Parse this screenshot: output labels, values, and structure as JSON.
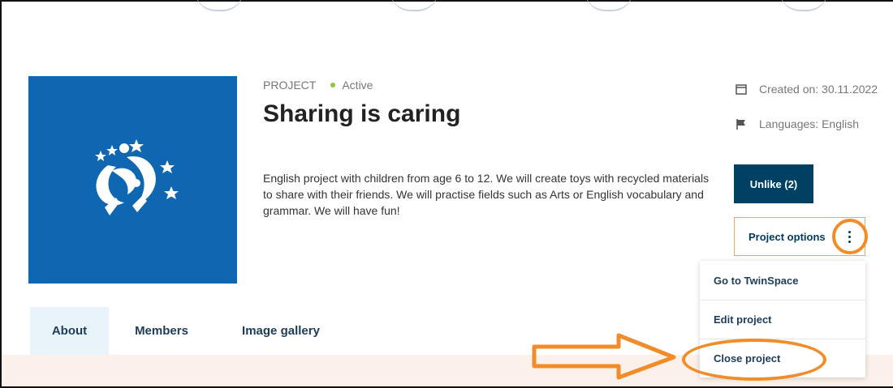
{
  "project": {
    "eyebrow": "PROJECT",
    "status": "Active",
    "title": "Sharing is caring",
    "description": "English project with children from age 6 to 12. We will create toys with recycled materials to share with their friends. We will practise fields such as Arts or English vocabulary and grammar. We will have fun!"
  },
  "meta": {
    "created": "Created on: 30.11.2022",
    "languages": "Languages: English"
  },
  "actions": {
    "unlike_label": "Unlike (2)",
    "options_label": "Project options"
  },
  "dropdown": {
    "items": [
      {
        "label": "Go to TwinSpace"
      },
      {
        "label": "Edit project"
      },
      {
        "label": "Close project"
      }
    ]
  },
  "tabs": [
    {
      "label": "About",
      "active": true
    },
    {
      "label": "Members",
      "active": false
    },
    {
      "label": "Image gallery",
      "active": false
    }
  ],
  "colors": {
    "image_background": "#0f66b1",
    "status_dot": "#8cc63f",
    "primary_button": "#004063",
    "annotation_orange": "#f28c28",
    "active_tab": "#e9f3fa"
  },
  "icons": {
    "logo": "children-stars-logo-icon",
    "created": "calendar-icon",
    "languages": "flag-icon",
    "options": "kebab-menu-icon",
    "annotation": "arrow-right-icon"
  }
}
